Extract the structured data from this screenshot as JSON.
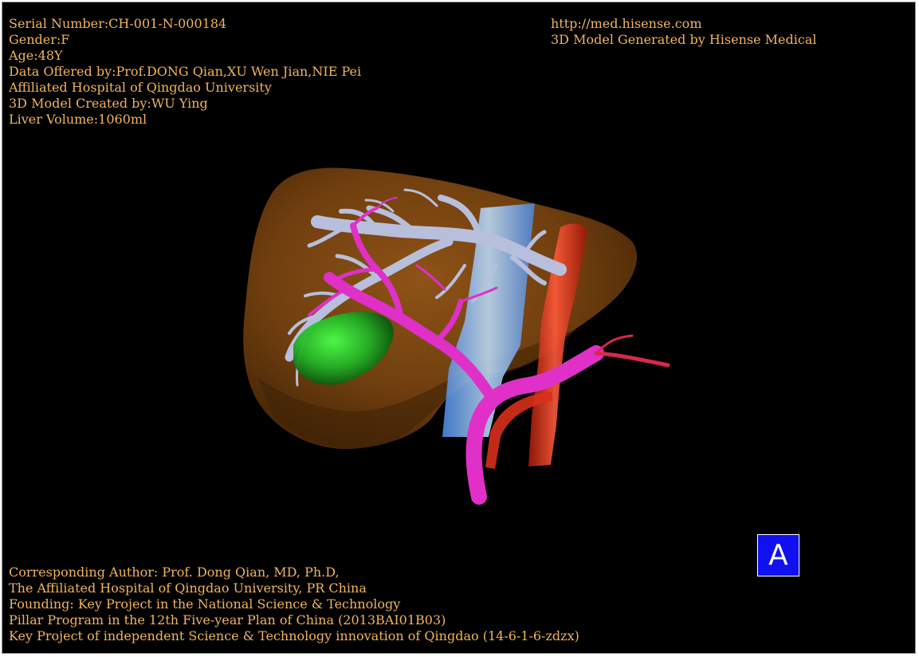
{
  "info_top_left": [
    "Serial Number:CH-001-N-000184",
    "Gender:F",
    "Age:48Y",
    "Data Offered by:Prof.DONG Qian,XU Wen Jian,NIE Pei",
    "Affiliated Hospital of Qingdao University",
    "3D Model Created by:WU Ying",
    "Liver Volume:1060ml"
  ],
  "info_top_right": [
    "http://med.hisense.com",
    "3D Model Generated by Hisense Medical"
  ],
  "credits_bottom_left": [
    "Corresponding Author: Prof. Dong Qian, MD, Ph.D,",
    "The Affiliated Hospital of Qingdao University, PR China",
    "Founding: Key Project in the National Science & Technology",
    "Pillar Program in the 12th Five-year Plan of China (2013BAI01B03)",
    "Key Project of independent Science & Technology innovation of Qingdao (14-6-1-6-zdzx)"
  ],
  "view_label": "A",
  "colors": {
    "background": "#000000",
    "text": "#f0b45a",
    "liver": "#7a4410",
    "hepatic_veins": "#b8bfdc",
    "portal_vein": "#e030c8",
    "inferior_vena_cava": "#8fc4f0",
    "aorta": "#e03a1e",
    "gallbladder": "#2fb832",
    "badge": "#1010f0"
  }
}
